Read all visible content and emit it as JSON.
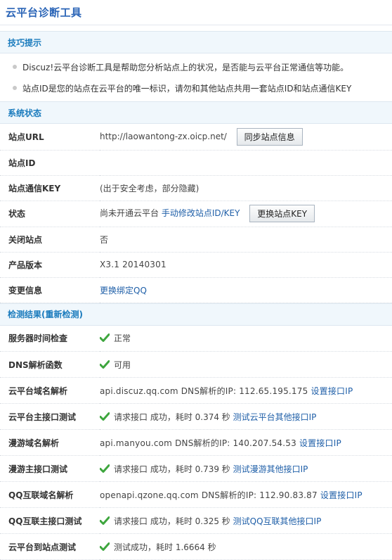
{
  "page_title": "云平台诊断工具",
  "tips": {
    "title": "技巧提示",
    "items": [
      "Discuz!云平台诊断工具是帮助您分析站点上的状况，是否能与云平台正常通信等功能。",
      "站点ID是您的站点在云平台的唯一标识，请勿和其他站点共用一套站点ID和站点通信KEY"
    ]
  },
  "system_status": {
    "title": "系统状态",
    "site_url": {
      "label": "站点URL",
      "value": "http://laowantong-zx.oicp.net/",
      "button": "同步站点信息"
    },
    "site_id": {
      "label": "站点ID",
      "value": ""
    },
    "site_key": {
      "label": "站点通信KEY",
      "value": "(出于安全考虑，部分隐藏)"
    },
    "status": {
      "label": "状态",
      "value": "尚未开通云平台",
      "link": "手动修改站点ID/KEY",
      "button": "更换站点KEY"
    },
    "site_closed": {
      "label": "关闭站点",
      "value": "否"
    },
    "version": {
      "label": "产品版本",
      "value": "X3.1 20140301"
    },
    "change_info": {
      "label": "变更信息",
      "link": "更换绑定QQ"
    }
  },
  "results": {
    "title": "检测结果(重新检测)",
    "server_time": {
      "label": "服务器时间检查",
      "value": "正常"
    },
    "dns": {
      "label": "DNS解析函数",
      "value": "可用"
    },
    "cloud_domain": {
      "label": "云平台域名解析",
      "value": "api.discuz.qq.com DNS解析的IP: 112.65.195.175",
      "link": "设置接口IP"
    },
    "cloud_main": {
      "label": "云平台主接口测试",
      "value": "请求接口 成功，耗时 0.374 秒",
      "link": "测试云平台其他接口IP"
    },
    "manyou_domain": {
      "label": "漫游域名解析",
      "value": "api.manyou.com DNS解析的IP: 140.207.54.53",
      "link": "设置接口IP"
    },
    "manyou_main": {
      "label": "漫游主接口测试",
      "value": "请求接口 成功，耗时 0.739 秒",
      "link": "测试漫游其他接口IP"
    },
    "qq_domain": {
      "label": "QQ互联域名解析",
      "value": "openapi.qzone.qq.com DNS解析的IP: 112.90.83.87",
      "link": "设置接口IP"
    },
    "qq_main": {
      "label": "QQ互联主接口测试",
      "value": "请求接口 成功，耗时 0.325 秒",
      "link": "测试QQ互联其他接口IP"
    },
    "cloud_to_site": {
      "label": "云平台到站点测试",
      "value": "测试成功，耗时 1.6664 秒"
    }
  },
  "colors": {
    "accent": "#1a7bbd",
    "check": "#3ea63e",
    "link": "#1f5fa8"
  }
}
